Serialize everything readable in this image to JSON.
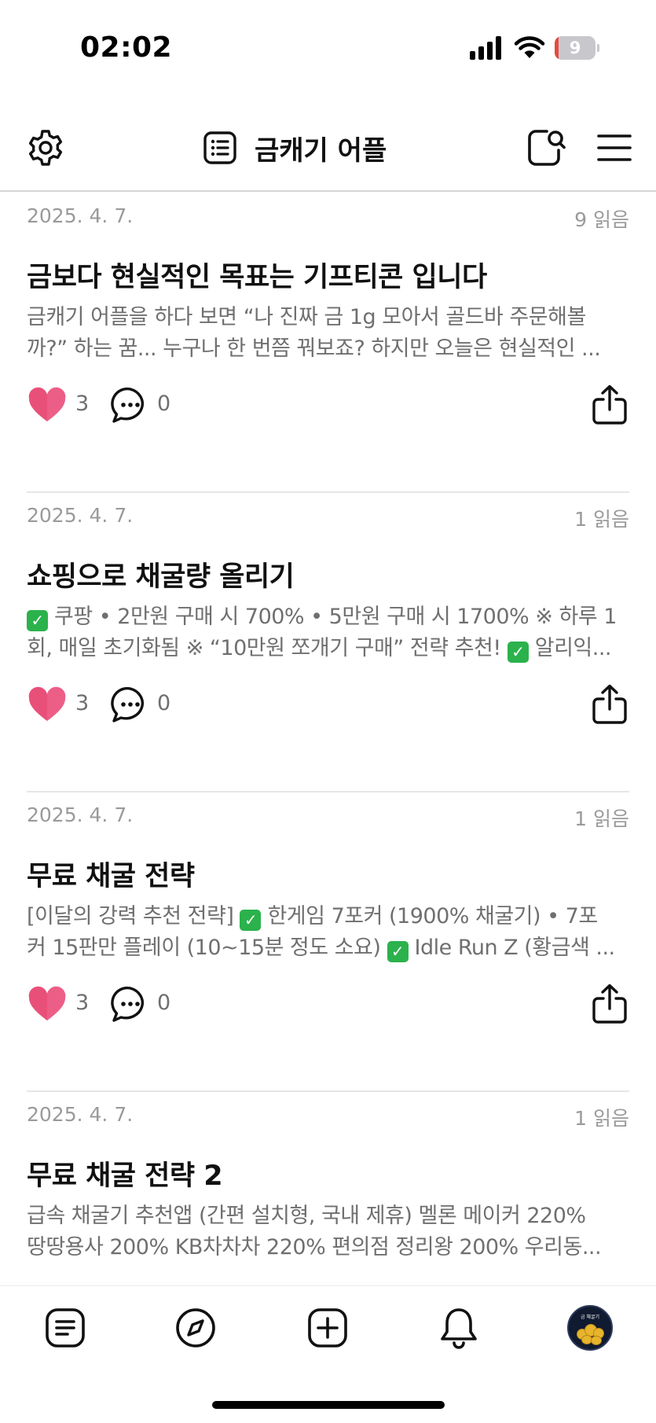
{
  "status_bar": {
    "time": "02:02",
    "battery_level": "9",
    "battery_fraction": 0.09,
    "colors": {
      "battery_low": "#e8493f"
    }
  },
  "header": {
    "title": "금캐기 어플",
    "icons": {
      "settings": "gear-icon",
      "title": "list-icon",
      "search": "search-icon",
      "menu": "hamburger-menu-icon"
    }
  },
  "posts": [
    {
      "date": "2025. 4. 7.",
      "reads": "9 읽음",
      "title": "금보다 현실적인 목표는 기프티콘 입니다",
      "excerpt_line1": "금캐기 어플을 하다 보면 “나 진짜 금 1g 모아서 골드바 주문해볼",
      "excerpt_line2": "까?” 하는 꿈... 누구나 한 번쯤 꿔보죠? 하지만 오늘은 현실적인 ...",
      "likes": "3",
      "comments": "0"
    },
    {
      "date": "2025. 4. 7.",
      "reads": "1 읽음",
      "title": "쇼핑으로 채굴량 올리기",
      "excerpt_line1": "쿠팡 • 2만원 구매 시 700% • 5만원 구매 시 1700% ※ 하루 1",
      "excerpt_line2a": "회, 매일 초기화됨 ※ “10만원 쪼개기 구매” 전략 추천!",
      "excerpt_line2b": "알리익...",
      "likes": "3",
      "comments": "0"
    },
    {
      "date": "2025. 4. 7.",
      "reads": "1 읽음",
      "title": "무료 채굴 전략",
      "excerpt_line1a": "[이달의 강력 추천 전략]",
      "excerpt_line1b": "한게임 7포커 (1900% 채굴기) • 7포",
      "excerpt_line2a": "커 15판만 플레이 (10~15분 정도 소요)",
      "excerpt_line2b": "Idle Run Z (황금색 ...",
      "likes": "3",
      "comments": "0"
    },
    {
      "date": "2025. 4. 7.",
      "reads": "1 읽음",
      "title": "무료 채굴 전략 2",
      "excerpt_line1": "급속 채굴기 추천앱 (간편 설치형, 국내 제휴) 멜론 메이커 220%",
      "excerpt_line2": "땅땅용사 200% KB차차차 220% 편의점 정리왕 200% 우리동...",
      "likes": "3",
      "comments": "0"
    }
  ],
  "tab_bar": {
    "tabs": [
      "feed-icon",
      "compass-icon",
      "add-post-icon",
      "bell-icon",
      "profile-avatar"
    ],
    "avatar_text": "금 채굴기"
  },
  "colors": {
    "like_heart": "#e8507a",
    "checkmark": "#2bb24c",
    "divider": "#e6e6e6"
  }
}
